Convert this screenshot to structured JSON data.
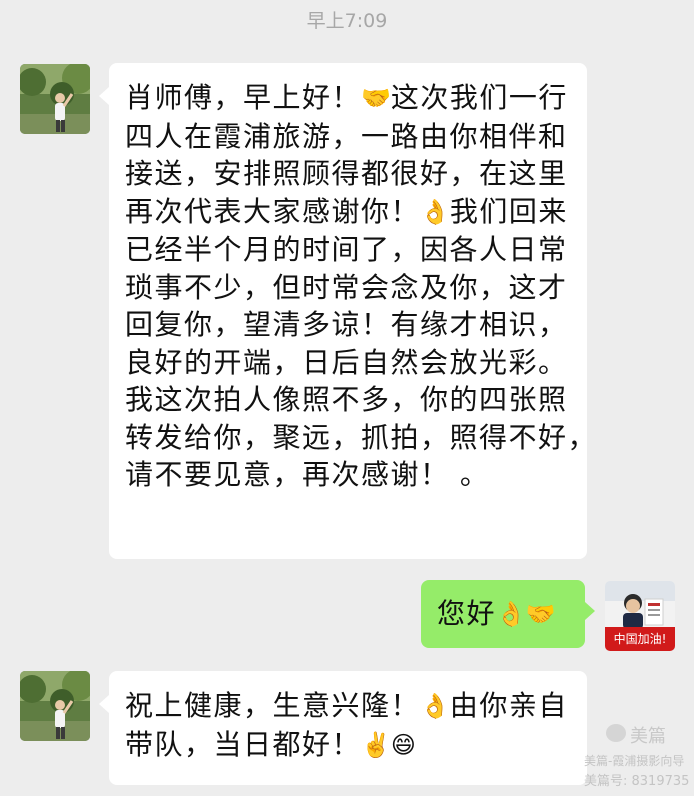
{
  "chat": {
    "timestamp": "早上7:09",
    "messages": [
      {
        "sender": "contact",
        "lines": [
          {
            "segments": [
              {
                "text": "肖师傅，早上好！"
              },
              {
                "emoji": "🤝"
              },
              {
                "text": "这次我们一行"
              }
            ]
          },
          {
            "segments": [
              {
                "text": "四人在霞浦旅游，一路由你相伴和"
              }
            ]
          },
          {
            "segments": [
              {
                "text": "接送，安排照顾得都很好，在这里"
              }
            ]
          },
          {
            "segments": [
              {
                "text": "再次代表大家感谢你！"
              },
              {
                "emoji": "👌"
              },
              {
                "text": "我们回来"
              }
            ]
          },
          {
            "segments": [
              {
                "text": "已经半个月的时间了，因各人日常"
              }
            ]
          },
          {
            "segments": [
              {
                "text": "琐事不少，但时常会念及你，这才"
              }
            ]
          },
          {
            "segments": [
              {
                "text": "回复你，望清多谅！有缘才相识，"
              }
            ]
          },
          {
            "segments": [
              {
                "text": "良好的开端，日后自然会放光彩。"
              }
            ]
          },
          {
            "segments": [
              {
                "text": "我这次拍人像照不多，你的四张照"
              }
            ]
          },
          {
            "segments": [
              {
                "text": "转发给你，聚远，抓拍，照得不好，"
              }
            ]
          },
          {
            "segments": [
              {
                "text": "请不要见意，再次感谢！ 。"
              }
            ]
          }
        ]
      },
      {
        "sender": "self",
        "lines": [
          {
            "segments": [
              {
                "text": "您好"
              },
              {
                "emoji": "👌"
              },
              {
                "emoji": "🤝"
              }
            ]
          }
        ]
      },
      {
        "sender": "contact",
        "lines": [
          {
            "segments": [
              {
                "text": "祝上健康，生意兴隆！"
              },
              {
                "emoji": "👌"
              },
              {
                "text": "由你亲自"
              }
            ]
          },
          {
            "segments": [
              {
                "text": "带队，当日都好！"
              },
              {
                "emoji": "✌️"
              },
              {
                "emoji": "😄"
              }
            ]
          }
        ]
      }
    ],
    "self_avatar_banner": "中国加油!",
    "watermark": {
      "logo": "美篇",
      "line1": "美篇-霞浦摄影向导",
      "line2": "美篇号: 8319735"
    },
    "colors": {
      "background": "#ededed",
      "contact_bubble": "#ffffff",
      "self_bubble": "#95ec69",
      "timestamp_text": "#a7a7a7"
    },
    "icons": {
      "contact_avatar": "person-photo-avatar",
      "self_avatar": "profile-photo-avatar"
    }
  }
}
